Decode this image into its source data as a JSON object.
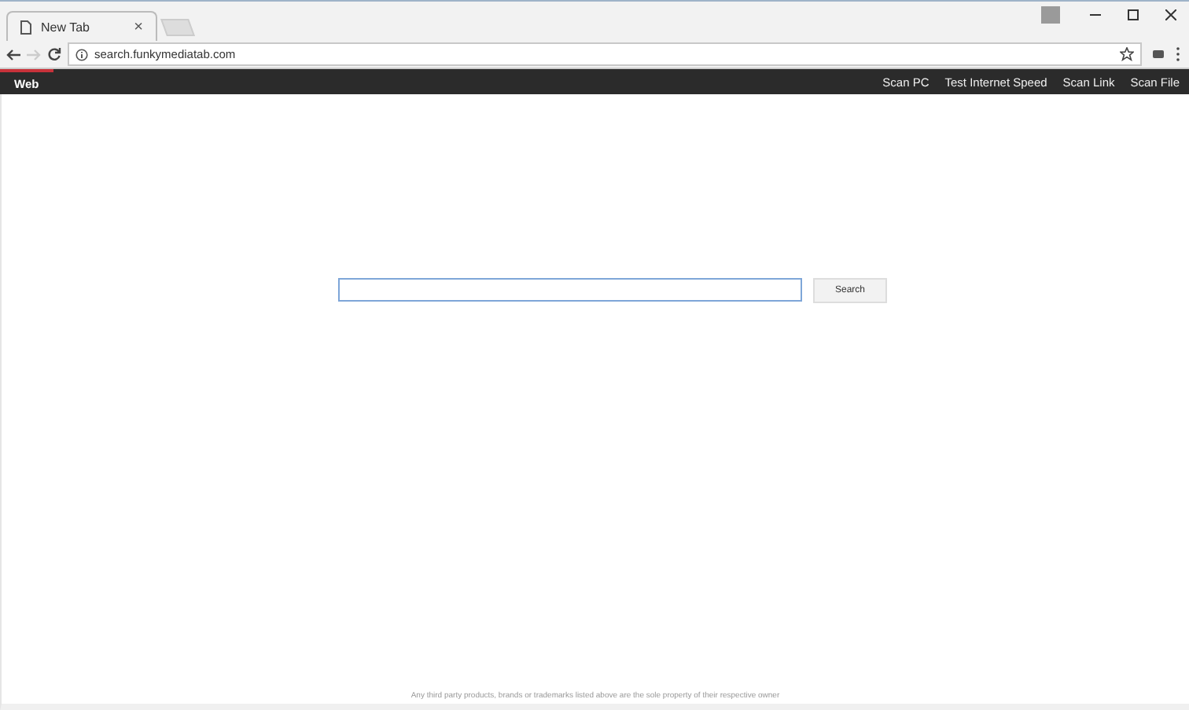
{
  "browser": {
    "tabs": [
      {
        "title": "New Tab",
        "close": "×",
        "selected": true
      }
    ],
    "address": "search.funkymediatab.com"
  },
  "nav": {
    "items": [
      {
        "label": "Web",
        "selected": true
      }
    ],
    "links": [
      "Scan PC",
      "Test Internet Speed",
      "Scan Link",
      "Scan File"
    ]
  },
  "search": {
    "button": "Search"
  },
  "footer": "Any third party products, brands or trademarks listed above are the sole property of their respective owner"
}
